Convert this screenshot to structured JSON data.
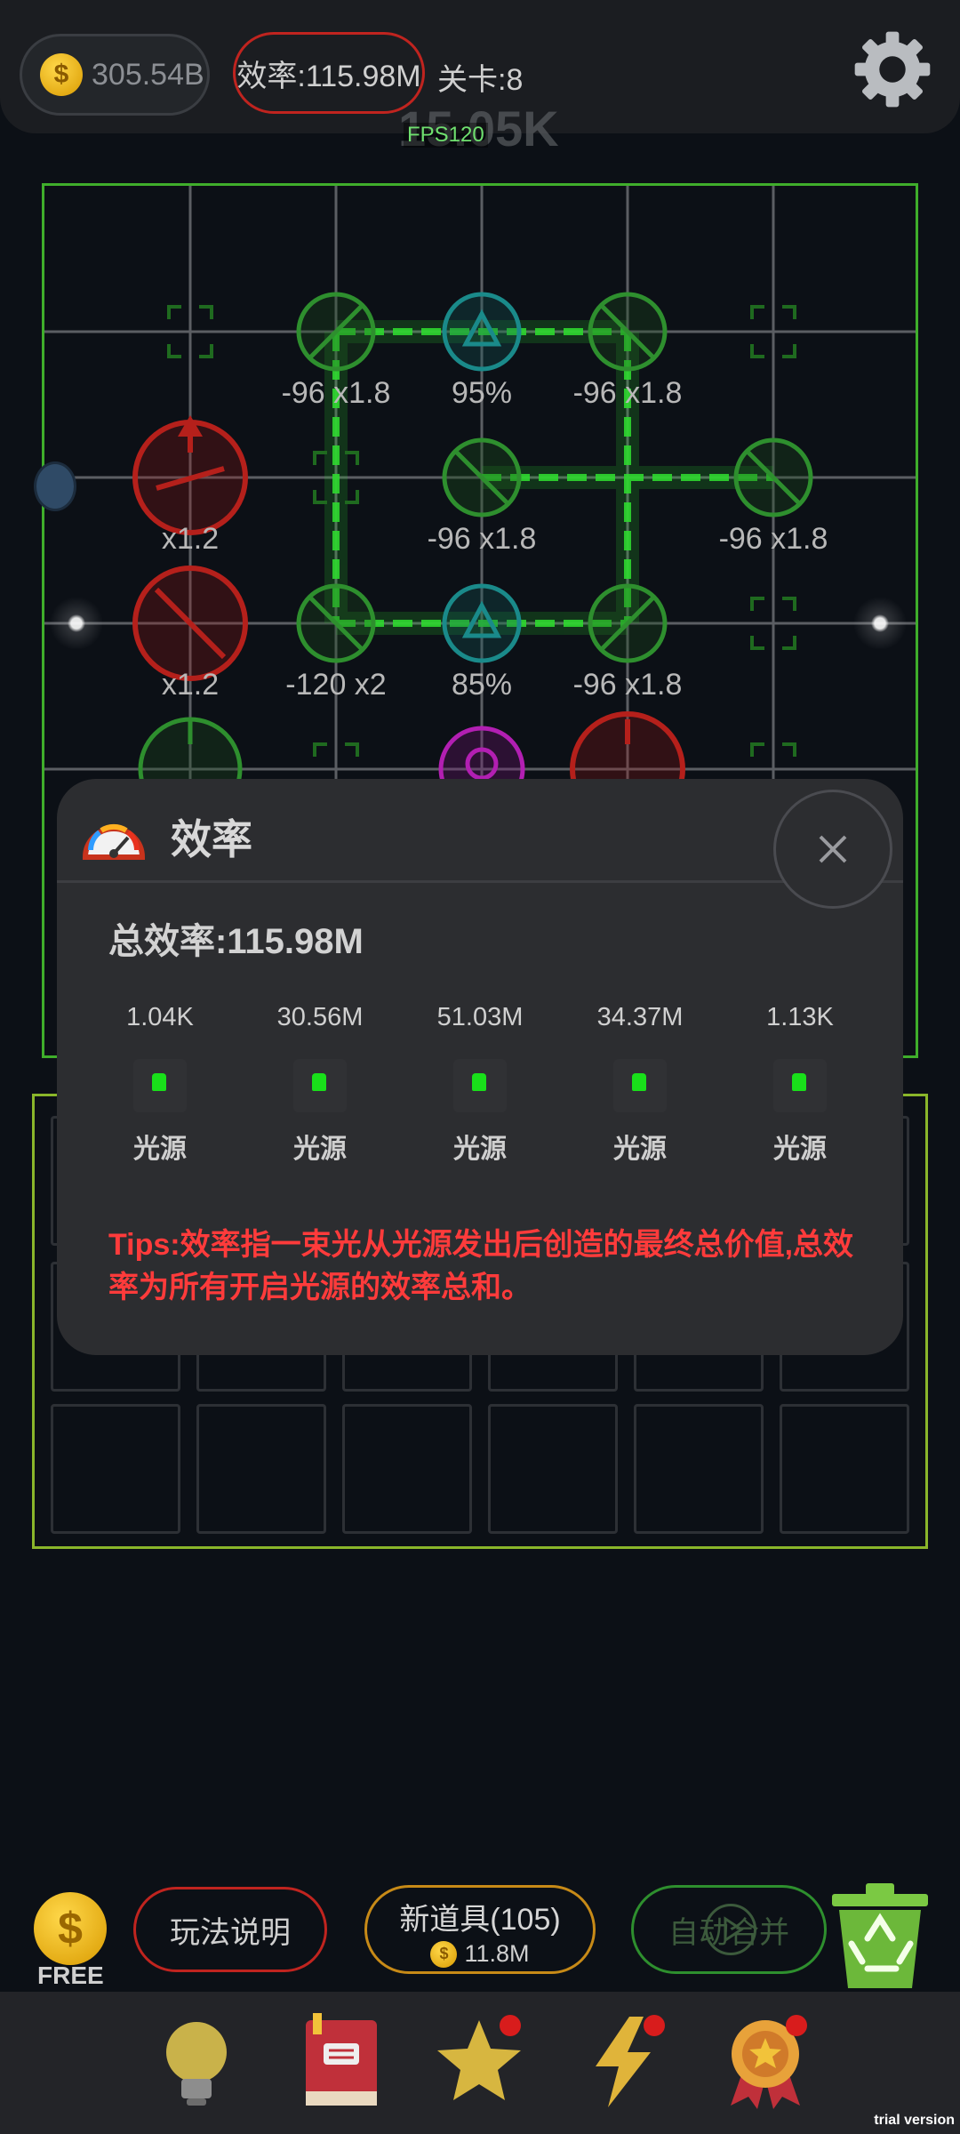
{
  "header": {
    "money": "305.54B",
    "efficiency": "效率:115.98M",
    "level": "关卡:8",
    "ghost_number": "15.05K",
    "fps": "FPS120"
  },
  "board": {
    "labels": [
      "-96 x1.8",
      "95%",
      "-96 x1.8",
      "x1.2",
      "-96 x1.8",
      "-96 x1.8",
      "x1.2",
      "-120 x2",
      "85%",
      "-96 x1.8"
    ]
  },
  "modal": {
    "title": "效率",
    "total": "总效率:115.98M",
    "columns": [
      {
        "value": "1.04K",
        "name": "光源"
      },
      {
        "value": "30.56M",
        "name": "光源"
      },
      {
        "value": "51.03M",
        "name": "光源"
      },
      {
        "value": "34.37M",
        "name": "光源"
      },
      {
        "value": "1.13K",
        "name": "光源"
      }
    ],
    "tips": "Tips:效率指一束光从光源发出后创造的最终总价值,总效率为所有开启光源的效率总和。"
  },
  "actions": {
    "free_label": "FREE",
    "guide_label": "玩法说明",
    "new_item_label": "新道具(105)",
    "new_item_price": "11.8M",
    "auto_merge_label": "自动合并"
  },
  "icons": {
    "settings": "gear-icon",
    "close": "close-icon",
    "recycle": "recycle-bin-icon",
    "nav": [
      "lightbulb-icon",
      "book-icon",
      "star-icon",
      "lightning-icon",
      "medal-icon"
    ]
  },
  "colors": {
    "green": "#3fae2b",
    "red": "#c0241f",
    "teal": "#1a8a8a",
    "magenta": "#b21fb2",
    "gold": "#c78a17",
    "tip_red": "#ff3b3b"
  },
  "watermark": "trial version"
}
